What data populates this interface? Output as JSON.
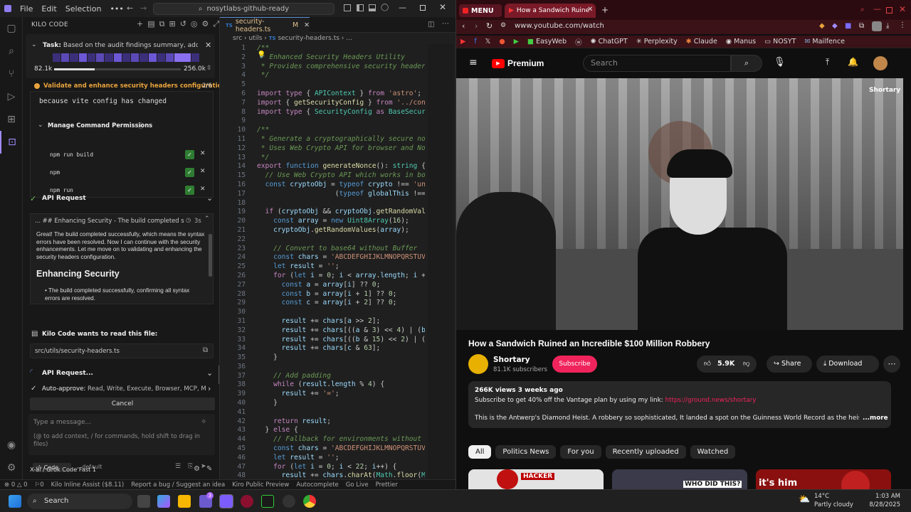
{
  "vscode": {
    "menu": [
      "File",
      "Edit",
      "Selection"
    ],
    "command_center": "nosytlabs-github-ready",
    "kilo": {
      "panel_title": "KILO CODE",
      "task_label": "Task:",
      "task_text": "Based on the audit findings summary, address cri...",
      "tokens_in": "82.1k",
      "tokens_max": "256.0k",
      "step_title": "Validate and enhance security headers configuration",
      "step_count": "2/6",
      "output_line": "because vite config has changed",
      "perm_title": "Manage Command Permissions",
      "permissions": [
        "npm run build",
        "npm",
        "npm run"
      ],
      "api_request_1": "API Request",
      "api_request_2": "API Request...",
      "summary_header": "... ## Enhancing Security - The build completed suc...",
      "summary_time": "3s",
      "summary_body": "Great! The build completed successfully, which means the syntax errors have been resolved. Now I can continue with the security enhancements. Let me move on to validating and enhancing the security headers configuration.",
      "summary_heading": "Enhancing Security",
      "summary_bullet": "The build completed successfully, confirming all syntax errors are resolved.",
      "read_file_title": "Kilo Code wants to read this file:",
      "read_file_path": "src/utils/security-headers.ts",
      "auto_approve_label": "Auto-approve:",
      "auto_approve_text": "Read, Write, Execute, Browser, MCP, Mode, ...",
      "cancel_label": "Cancel",
      "input_placeholder": "Type a message...",
      "input_hint": "(@ to add context, / for commands, hold shift to drag in files)",
      "mode_label": "Code",
      "profile_label": "default",
      "model_label": "X-ai / Grok Code Fast 1"
    },
    "editor": {
      "tab_label": "security-headers.ts",
      "tab_badge": "M",
      "breadcrumb": [
        "src",
        "utils",
        "security-headers.ts",
        "..."
      ]
    },
    "status": [
      "⊗ 0 △ 0",
      "⚐0",
      "Kilo Inline Assist ($8.11)",
      "Report a bug / Suggest an idea",
      "Kiro Public Preview",
      "Autocomplete",
      "Go Live",
      "Prettier"
    ]
  },
  "chrome": {
    "tabs": [
      {
        "label": "MENU"
      },
      {
        "label": "How a Sandwich Ruine"
      }
    ],
    "url": "www.youtube.com/watch",
    "bookmarks": [
      "EasyWeb",
      "ChatGPT",
      "Perplexity",
      "Claude",
      "Manus",
      "NOSYT",
      "Mailfence"
    ],
    "yt": {
      "logo_text": "Premium",
      "search_placeholder": "Search",
      "video_watermark": "Shortary",
      "title": "How a Sandwich Ruined an Incredible $100 Million Robbery",
      "channel": "Shortary",
      "subscribers": "81.1K subscribers",
      "subscribe": "Subscribe",
      "likes": "5.9K",
      "share": "Share",
      "download": "Download",
      "views": "266K views  3 weeks ago",
      "desc_line1": "Subscribe to get 40% off the Vantage plan by using my link: ",
      "desc_link": "https://ground.news/shortary",
      "desc_line2": "This is the Antwerp's Diamond Heist. A robbery so sophisticated, It landed a spot on the Guinness World Record as the heist of the c",
      "more": "...more",
      "chips": [
        "All",
        "Politics News",
        "For you",
        "Recently uploaded",
        "Watched"
      ],
      "thumb_texts": [
        "HACKER",
        "WHO DID THIS?",
        "it's him"
      ]
    }
  },
  "taskbar": {
    "search": "Search",
    "weather_temp": "14°C",
    "weather_desc": "Partly cloudy",
    "time": "1:03 AM",
    "date": "8/28/2025",
    "badge": "3"
  }
}
